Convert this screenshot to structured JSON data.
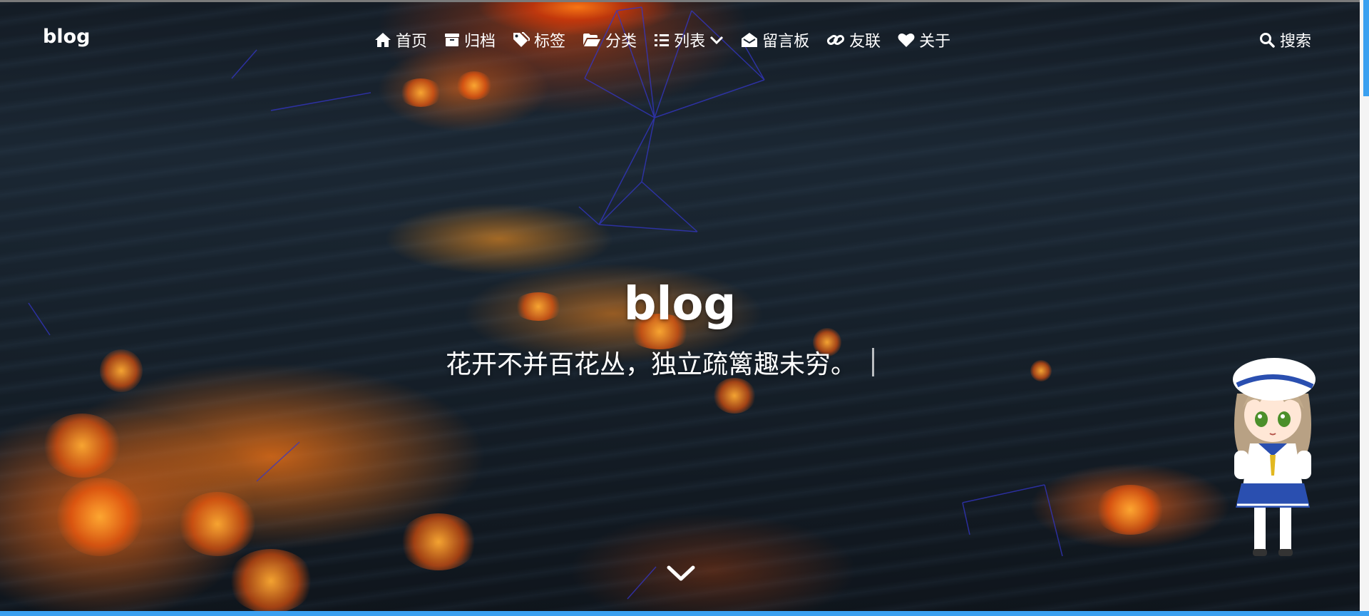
{
  "brand": "blog",
  "nav": {
    "items": [
      {
        "label": "首页",
        "icon": "home-icon"
      },
      {
        "label": "归档",
        "icon": "archive-icon"
      },
      {
        "label": "标签",
        "icon": "tags-icon"
      },
      {
        "label": "分类",
        "icon": "folder-open-icon"
      },
      {
        "label": "列表",
        "icon": "list-icon",
        "dropdown": true
      },
      {
        "label": "留言板",
        "icon": "envelope-open-icon"
      },
      {
        "label": "友联",
        "icon": "link-icon"
      },
      {
        "label": "关于",
        "icon": "heart-icon"
      }
    ],
    "search_label": "搜索"
  },
  "hero": {
    "title": "blog",
    "subtitle": "花开不并百花丛，独立疏篱趣未穷。"
  },
  "colors": {
    "accent": "#3aa0f0",
    "text": "#ffffff",
    "background": "#16202a",
    "lava": "#ff7a1a"
  }
}
